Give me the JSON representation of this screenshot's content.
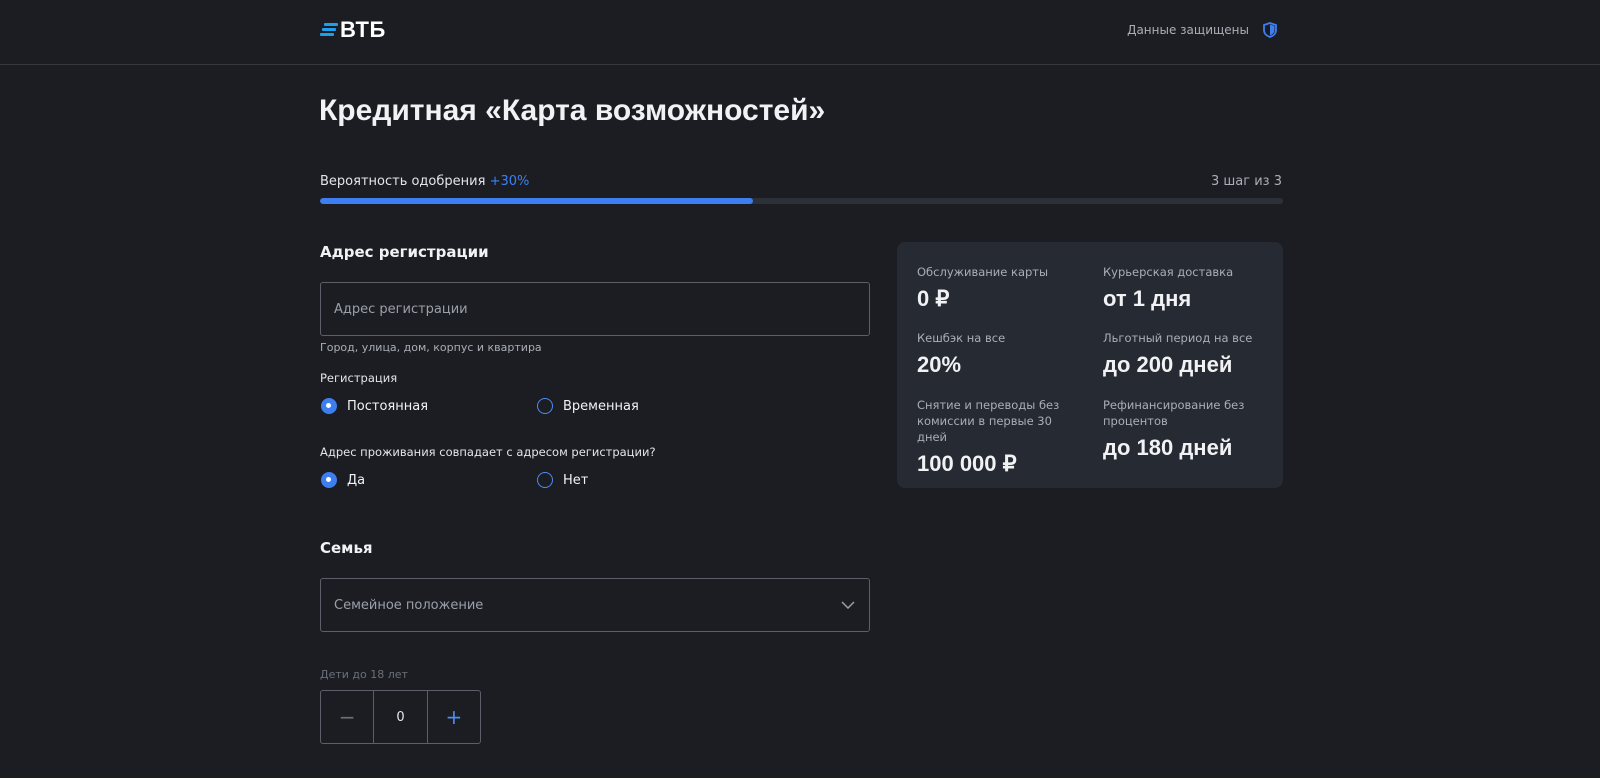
{
  "header": {
    "logo_text": "ВТБ",
    "secure_label": "Данные защищены",
    "secure_icon": "shield-icon",
    "accent_color": "#1d9ff0"
  },
  "page": {
    "title": "Кредитная «Карта возможностей»"
  },
  "progress": {
    "label": "Вероятность одобрения",
    "bonus": "+30%",
    "step": "3 шаг из 3",
    "fill_fraction": 0.45,
    "fill_color": "#3d7ff0"
  },
  "address": {
    "section_title": "Адрес регистрации",
    "input_placeholder": "Адрес регистрации",
    "input_value": "",
    "hint": "Город, улица, дом, корпус и квартира",
    "registration_label": "Регистрация",
    "registration_options": [
      {
        "label": "Постоянная",
        "checked": true
      },
      {
        "label": "Временная",
        "checked": false
      }
    ],
    "same_address_label": "Адрес проживания совпадает с адресом регистрации?",
    "same_address_options": [
      {
        "label": "Да",
        "checked": true
      },
      {
        "label": "Нет",
        "checked": false
      }
    ]
  },
  "family": {
    "section_title": "Семья",
    "marital_placeholder": "Семейное положение",
    "children_label": "Дети до 18 лет",
    "children_value": "0",
    "minus_symbol": "−",
    "plus_symbol": "+"
  },
  "benefits": [
    {
      "label": "Обслуживание карты",
      "value": "0 ₽"
    },
    {
      "label": "Курьерская доставка",
      "value": "от 1 дня"
    },
    {
      "label": "Кешбэк на все",
      "value": "20%"
    },
    {
      "label": "Льготный период на все",
      "value": "до 200 дней"
    },
    {
      "label": "Снятие и переводы без комиссии в первые 30 дней",
      "value": "100 000 ₽"
    },
    {
      "label": "Рефинансирование без процентов",
      "value": "до 180 дней"
    }
  ]
}
